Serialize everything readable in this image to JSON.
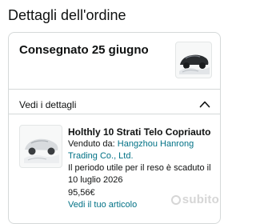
{
  "page": {
    "title": "Dettagli dell'ordine"
  },
  "shipment": {
    "status": "Consegnato 25 giugno",
    "thumbnail_icon": "car-cover-product-image"
  },
  "details_toggle": {
    "label": "Vedi i dettagli",
    "icon": "chevron-up-icon"
  },
  "item": {
    "thumbnail_icon": "car-cover-product-image",
    "title": "Holthly 10 Strati Telo Copriauto",
    "sold_by_label": "Venduto da:",
    "seller": "Hangzhou Hanrong Trading Co., Ltd.",
    "return_notice": "Il periodo utile per il reso è scaduto il 10 luglio 2026",
    "price": "95,56€",
    "view_item_label": "Vedi il tuo articolo"
  },
  "watermark": {
    "text": "subito"
  },
  "colors": {
    "text": "#0f1111",
    "link": "#007185",
    "border": "#d5d9d9"
  }
}
